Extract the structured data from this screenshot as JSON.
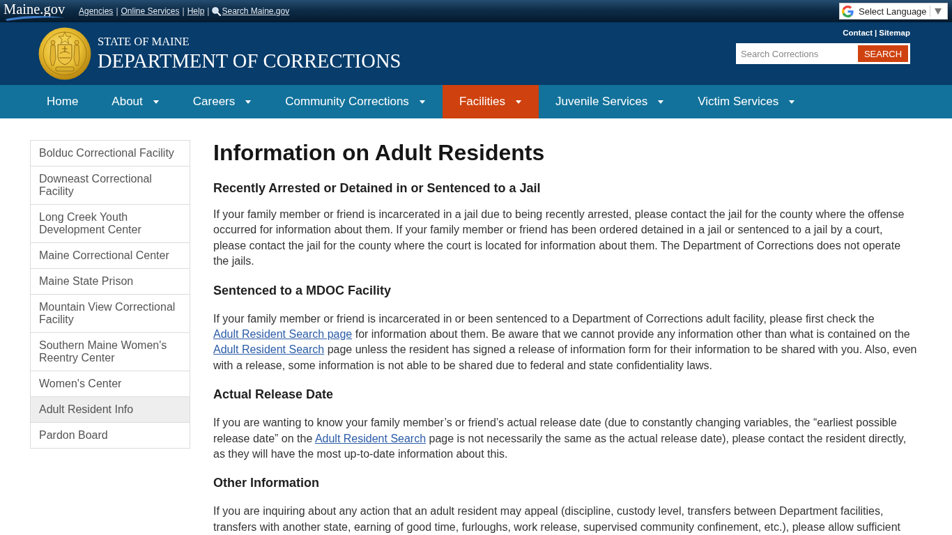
{
  "top_bar": {
    "logo": "Maine.gov",
    "links": [
      {
        "kind": "link",
        "label": "Agencies"
      },
      {
        "kind": "separator",
        "label": "|"
      },
      {
        "kind": "link",
        "label": "Online Services"
      },
      {
        "kind": "separator",
        "label": "|"
      },
      {
        "kind": "link",
        "label": "Help"
      },
      {
        "kind": "separator",
        "label": "|"
      },
      {
        "kind": "search",
        "label": "Search Maine.gov"
      }
    ],
    "language_select": {
      "label": "Select Language"
    }
  },
  "header": {
    "subtitle": "STATE OF MAINE",
    "title": "DEPARTMENT OF CORRECTIONS",
    "utility_links": [
      {
        "kind": "link",
        "label": "Contact"
      },
      {
        "kind": "separator",
        "label": "|"
      },
      {
        "kind": "link",
        "label": "Sitemap"
      }
    ],
    "search": {
      "placeholder": "Search Corrections",
      "button": "SEARCH"
    }
  },
  "nav": [
    {
      "label": "Home",
      "has_menu": false,
      "selected": false
    },
    {
      "label": "About",
      "has_menu": true,
      "selected": false
    },
    {
      "label": "Careers",
      "has_menu": true,
      "selected": false
    },
    {
      "label": "Community Corrections",
      "has_menu": true,
      "selected": false
    },
    {
      "label": "Facilities",
      "has_menu": true,
      "selected": true
    },
    {
      "label": "Juvenile Services",
      "has_menu": true,
      "selected": false
    },
    {
      "label": "Victim Services",
      "has_menu": true,
      "selected": false
    }
  ],
  "sidebar": {
    "items": [
      {
        "label": "Bolduc Correctional Facility",
        "selected": false
      },
      {
        "label": "Downeast Correctional Facility",
        "selected": false
      },
      {
        "label": "Long Creek Youth Development Center",
        "selected": false
      },
      {
        "label": "Maine Correctional Center",
        "selected": false
      },
      {
        "label": "Maine State Prison",
        "selected": false
      },
      {
        "label": "Mountain View Correctional Facility",
        "selected": false
      },
      {
        "label": "Southern Maine Women's Reentry Center",
        "selected": false
      },
      {
        "label": "Women's Center",
        "selected": false
      },
      {
        "label": "Adult Resident Info",
        "selected": true
      },
      {
        "label": "Pardon Board",
        "selected": false
      }
    ]
  },
  "content": {
    "title": "Information on Adult Residents",
    "sections": [
      {
        "heading": "Recently Arrested or Detained in or Sentenced to a Jail",
        "body": [
          {
            "kind": "text",
            "text": "If your family member or friend is incarcerated in a jail due to being recently arrested, please contact the jail for the county where the offense occurred for information about them. If your family member or friend has been ordered detained in a jail or sentenced to a jail by a court, please contact the jail for the county where the court is located for information about them. The Department of Corrections does not operate the jails."
          }
        ]
      },
      {
        "heading": "Sentenced to a MDOC Facility",
        "body": [
          {
            "kind": "text",
            "text": "If your family member or friend is incarcerated in or been sentenced to a Department of Corrections adult facility, please first check the "
          },
          {
            "kind": "link",
            "text": "Adult Resident Search page"
          },
          {
            "kind": "text",
            "text": " for information about them. Be aware that we cannot provide any information other than what is contained on the "
          },
          {
            "kind": "link",
            "text": "Adult Resident Search"
          },
          {
            "kind": "text",
            "text": " page unless the resident has signed a release of information form for their information to be shared with you. Also, even with a release, some information is not able to be shared due to federal and state confidentiality laws."
          }
        ]
      },
      {
        "heading": "Actual Release Date",
        "body": [
          {
            "kind": "text",
            "text": "If you are wanting to know your family member’s or friend’s actual release date (due to constantly changing variables, the “earliest possible release date” on the "
          },
          {
            "kind": "link",
            "text": "Adult Resident Search"
          },
          {
            "kind": "text",
            "text": " page is not necessarily the same as the actual release date), please contact the resident directly, as they will have the most up-to-date information about this."
          }
        ]
      },
      {
        "heading": "Other Information",
        "body": [
          {
            "kind": "text",
            "text": "If you are inquiring about any action that an adult resident may appeal (discipline, custody level, transfers between Department facilities, transfers with another state, earning of good time, furloughs, work release, supervised community confinement, etc.), please allow sufficient"
          }
        ]
      }
    ]
  }
}
